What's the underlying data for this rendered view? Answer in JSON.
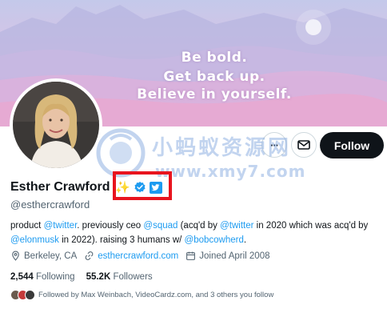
{
  "banner": {
    "lines": [
      "Be bold.",
      "Get back up.",
      "Believe in yourself."
    ]
  },
  "actions": {
    "more_label": "···",
    "follow_label": "Follow"
  },
  "profile": {
    "name": "Esther Crawford",
    "handle": "@esthercrawford",
    "badges": [
      "sparkle-icon",
      "verified-icon",
      "twitter-icon"
    ]
  },
  "bio": {
    "t1": "product ",
    "l1": "@twitter",
    "t2": ". previously ceo ",
    "l2": "@squad",
    "t3": " (acq'd by ",
    "l3": "@twitter",
    "t4": " in 2020 which was acq'd by ",
    "l4": "@elonmusk",
    "t5": " in 2022). raising 3 humans w/ ",
    "l5": "@bobcowherd",
    "t6": "."
  },
  "meta": {
    "location": "Berkeley, CA",
    "website": "esthercrawford.com",
    "joined": "Joined April 2008"
  },
  "stats": {
    "following_count": "2,544",
    "following_label": "Following",
    "followers_count": "55.2K",
    "followers_label": "Followers"
  },
  "followed_by": "Followed by Max Weinbach, VideoCardz.com, and 3 others you follow",
  "watermark": {
    "cn": "小蚂蚁资源网",
    "url": "www.xmy7.com"
  },
  "colors": {
    "accent": "#1d9bf0",
    "follow_bg": "#0f1419",
    "highlight_box": "#e8141e",
    "muted_text": "#536471"
  }
}
